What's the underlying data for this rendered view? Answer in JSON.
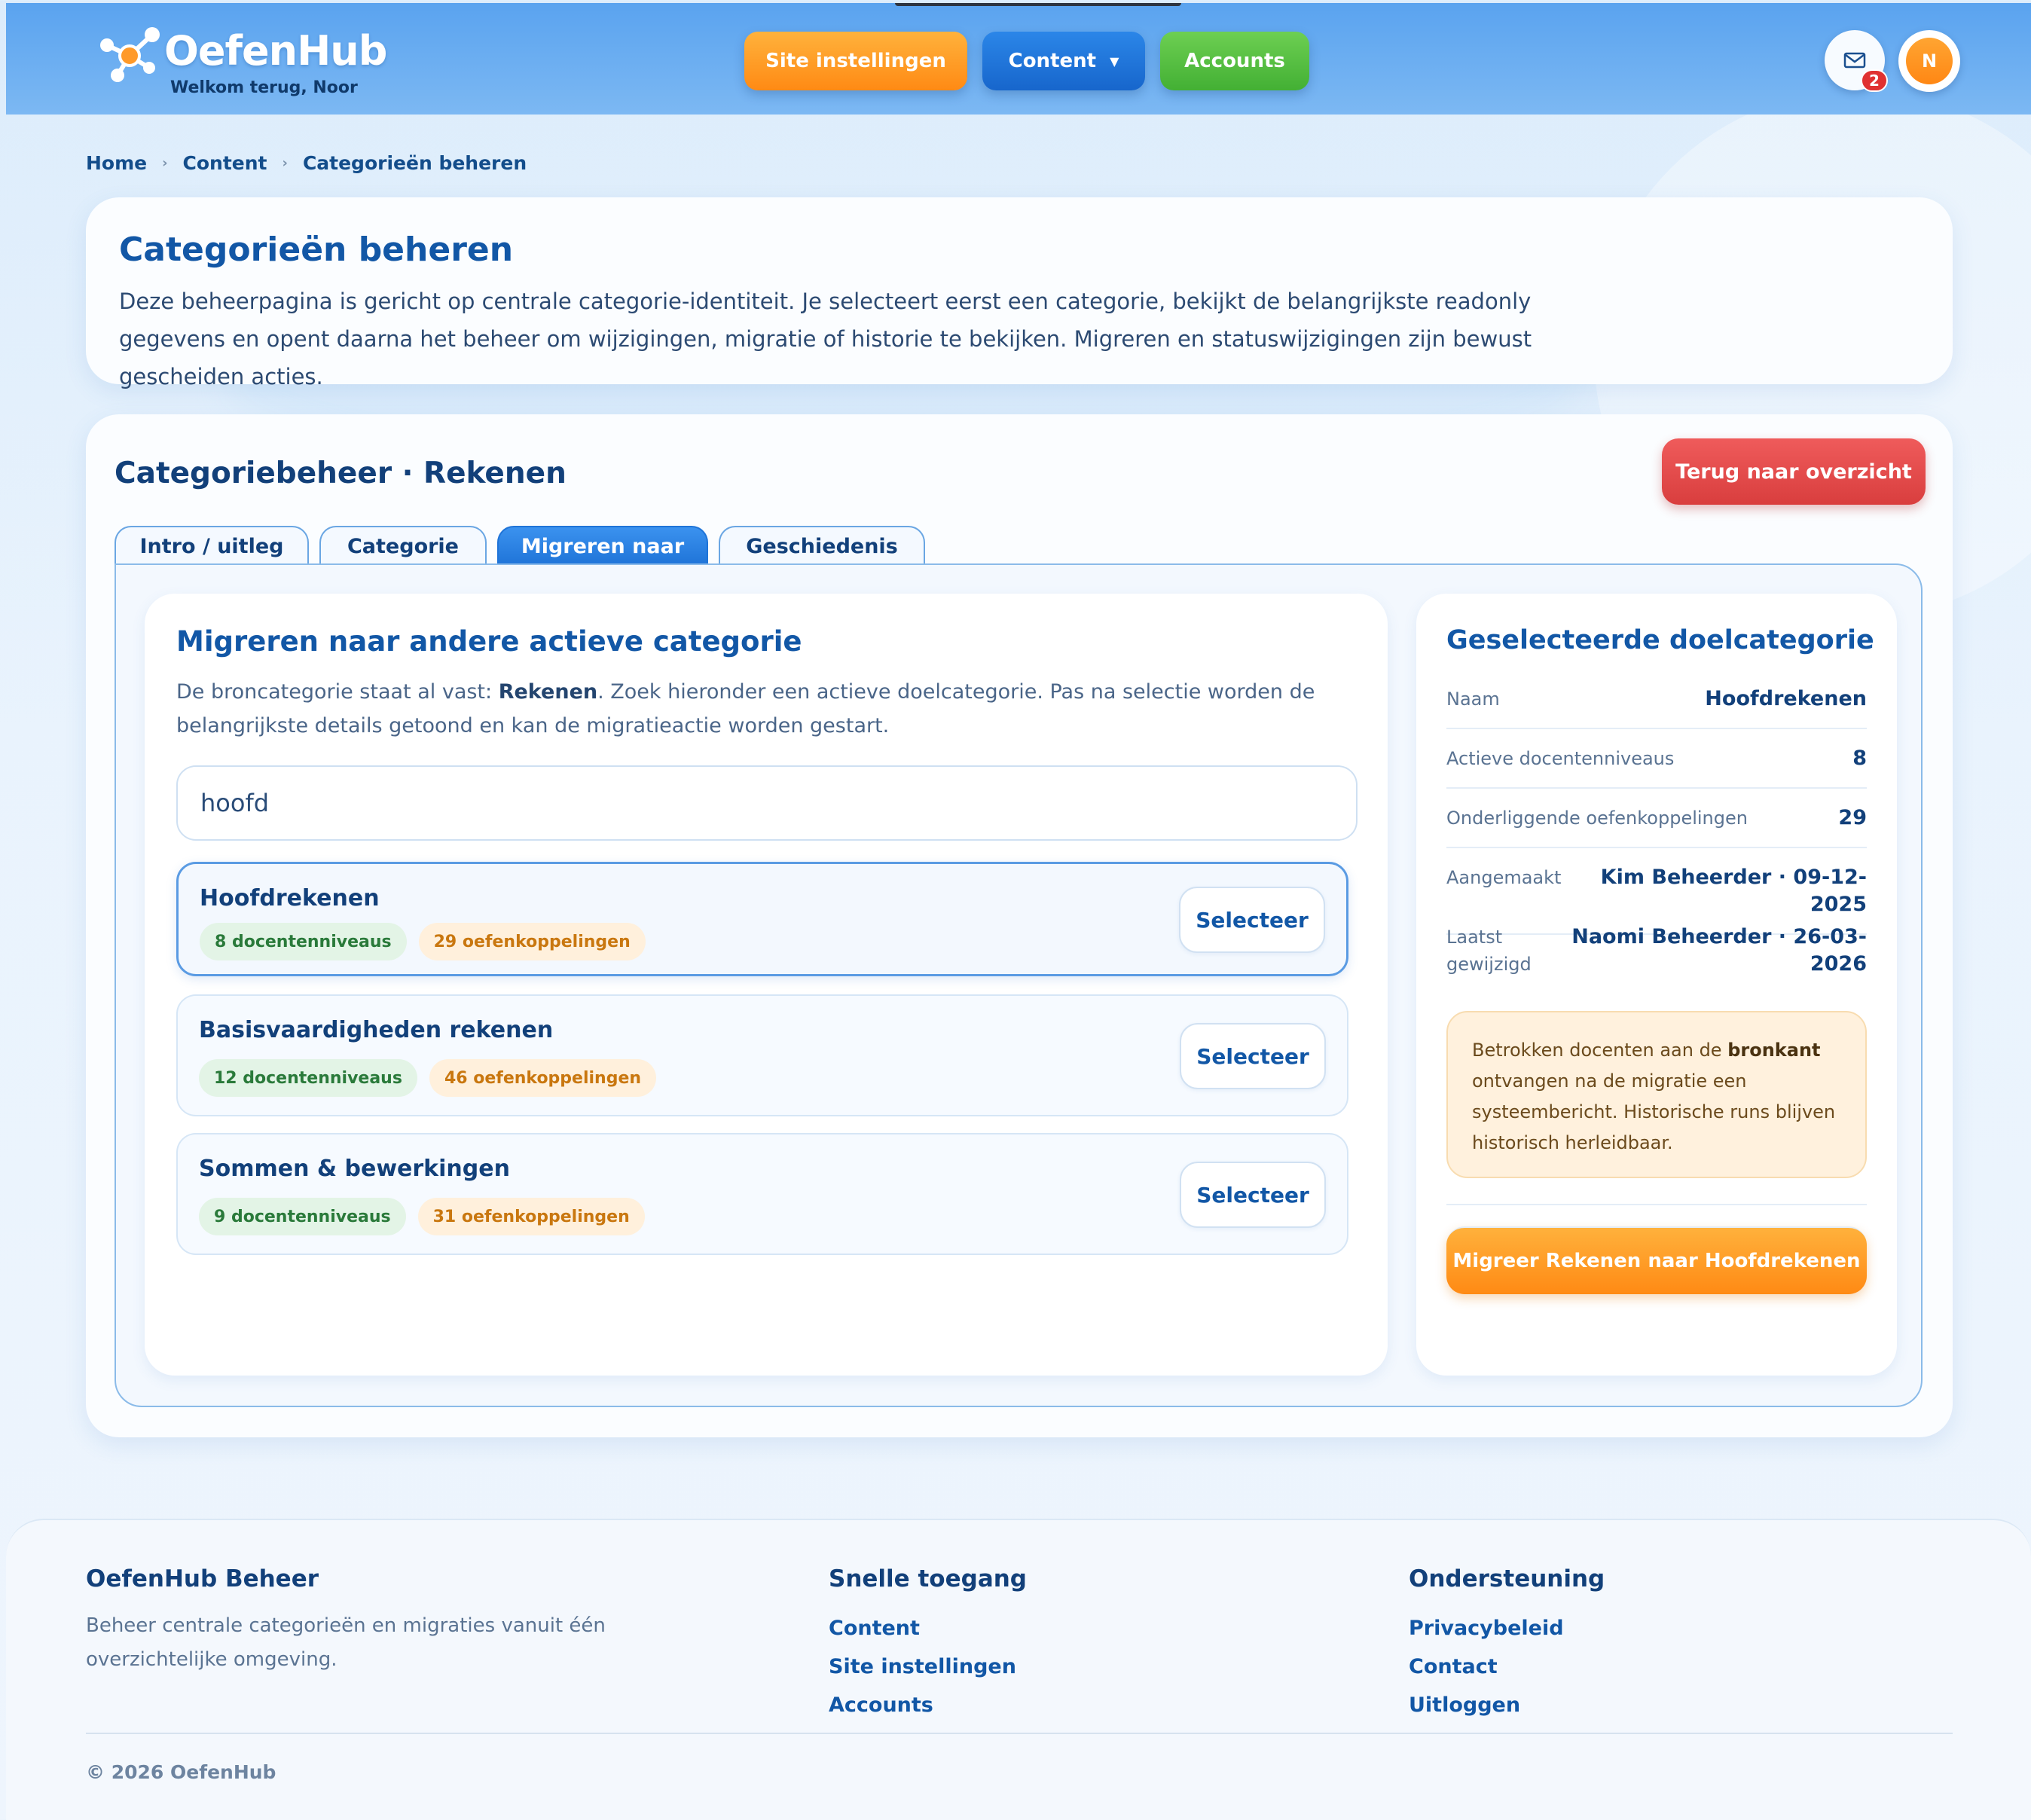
{
  "header": {
    "brand": "OefenHub",
    "welcome": "Welkom terug, Noor",
    "nav": {
      "site_settings": "Site instellingen",
      "content": "Content",
      "accounts": "Accounts"
    },
    "mail_badge": "2",
    "avatar_initial": "N",
    "colors": {
      "orange": "#ff8a14",
      "blue": "#1766cc",
      "green": "#43b034"
    }
  },
  "breadcrumb": [
    "Home",
    "Content",
    "Categorieën beheren"
  ],
  "intro": {
    "title": "Categorieën beheren",
    "text": "Deze beheerpagina is gericht op centrale categorie-identiteit. Je selecteert eerst een categorie, bekijkt de belangrijkste readonly gegevens en opent daarna het beheer om wijzigingen, migratie of historie te bekijken. Migreren en statuswijzigingen zijn bewust gescheiden acties."
  },
  "main": {
    "title": "Categoriebeheer · Rekenen",
    "back_button": "Terug naar overzicht",
    "tabs": [
      {
        "label": "Intro / uitleg",
        "active": false
      },
      {
        "label": "Categorie",
        "active": false
      },
      {
        "label": "Migreren naar",
        "active": true
      },
      {
        "label": "Geschiedenis",
        "active": false
      }
    ],
    "migrate": {
      "title": "Migreren naar andere actieve categorie",
      "desc_prefix": "De broncategorie staat al vast: ",
      "desc_source": "Rekenen",
      "desc_suffix": ". Zoek hieronder een actieve doelcategorie. Pas na selectie worden de belangrijkste details getoond en kan de migratieactie worden gestart.",
      "search_value": "hoofd",
      "results": [
        {
          "name": "Hoofdrekenen",
          "levels": "8 docentenniveaus",
          "links": "29 oefenkoppelingen",
          "button": "Selecteer",
          "selected": true
        },
        {
          "name": "Basisvaardigheden rekenen",
          "levels": "12 docentenniveaus",
          "links": "46 oefenkoppelingen",
          "button": "Selecteer",
          "selected": false
        },
        {
          "name": "Sommen & bewerkingen",
          "levels": "9 docentenniveaus",
          "links": "31 oefenkoppelingen",
          "button": "Selecteer",
          "selected": false
        }
      ]
    },
    "target": {
      "title": "Geselecteerde doelcategorie",
      "rows": [
        {
          "label": "Naam",
          "value": "Hoofdrekenen"
        },
        {
          "label": "Actieve docentenniveaus",
          "value": "8"
        },
        {
          "label": "Onderliggende oefenkoppelingen",
          "value": "29"
        },
        {
          "label": "Aangemaakt",
          "value": "Kim Beheerder · 09-12-2025"
        },
        {
          "label": "Laatst gewijzigd",
          "value": "Naomi Beheerder · 26-03-2026"
        }
      ],
      "info_prefix": "Betrokken docenten aan de ",
      "info_bold": "bronkant",
      "info_suffix": " ontvangen na de migratie een systeembericht. Historische runs blijven historisch herleidbaar.",
      "migrate_button": "Migreer Rekenen naar Hoofdrekenen"
    }
  },
  "footer": {
    "brand_title": "OefenHub Beheer",
    "brand_text": "Beheer centrale categorieën en migraties vanuit één overzichtelijke omgeving.",
    "quick_title": "Snelle toegang",
    "quick_links": [
      "Content",
      "Site instellingen",
      "Accounts"
    ],
    "support_title": "Ondersteuning",
    "support_links": [
      "Privacybeleid",
      "Contact",
      "Uitloggen"
    ],
    "copyright": "© 2026 OefenHub"
  }
}
